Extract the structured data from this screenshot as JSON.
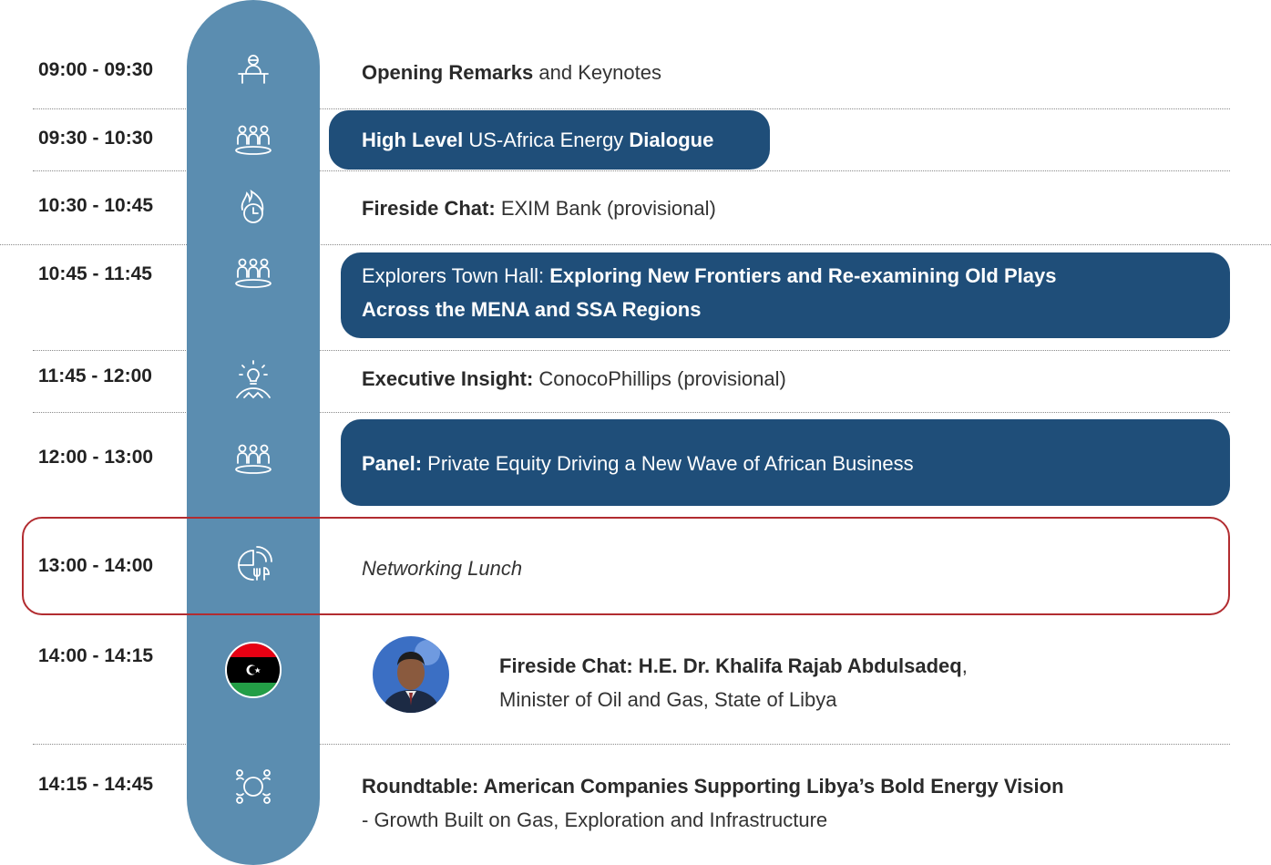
{
  "sessions": [
    {
      "time": "09:00 - 09:30",
      "icon": "speaker-podium-icon",
      "bold1": "Opening Remarks",
      "rest1": " and Keynotes"
    },
    {
      "time": "09:30 - 10:30",
      "icon": "group-meeting-icon",
      "bold1": "High Level",
      "mid": " US-Africa Energy ",
      "bold2": "Dialogue"
    },
    {
      "time": "10:30 - 10:45",
      "icon": "fireside-clock-icon",
      "bold1": "Fireside Chat:",
      "rest1": " EXIM Bank (provisional)"
    },
    {
      "time": "10:45 - 11:45",
      "icon": "group-meeting-icon",
      "pre": "Explorers Town Hall: ",
      "bold1": "Exploring New Frontiers and Re-examining Old Plays",
      "bold2": "Across the MENA and SSA Regions"
    },
    {
      "time": "11:45 - 12:00",
      "icon": "lightbulb-hands-icon",
      "bold1": "Executive Insight:",
      "rest1": " ConocoPhillips (provisional)"
    },
    {
      "time": "12:00 - 13:00",
      "icon": "group-meeting-icon",
      "bold1": "Panel:",
      "rest1": " Private Equity Driving a New Wave of African Business"
    },
    {
      "time": "13:00 - 14:00",
      "icon": "lunch-globe-icon",
      "italic": "Networking Lunch"
    },
    {
      "time": "14:00 - 14:15",
      "icon": "libya-flag-icon",
      "bold1": "Fireside Chat: H.E. Dr. Khalifa Rajab Abdulsadeq",
      "rest1": ",",
      "line2": "Minister of Oil and Gas, State of Libya"
    },
    {
      "time": "14:15 - 14:45",
      "icon": "roundtable-icon",
      "bold1": "Roundtable: American Companies Supporting Libya’s Bold Energy Vision",
      "line2": "- Growth Built on Gas, Exploration and Infrastructure"
    }
  ],
  "colors": {
    "timeline": "#5b8db0",
    "pill": "#1f4e79",
    "highlight_border": "#b22c30",
    "flag_red": "#e70013",
    "flag_black": "#000000",
    "flag_green": "#239e46"
  }
}
